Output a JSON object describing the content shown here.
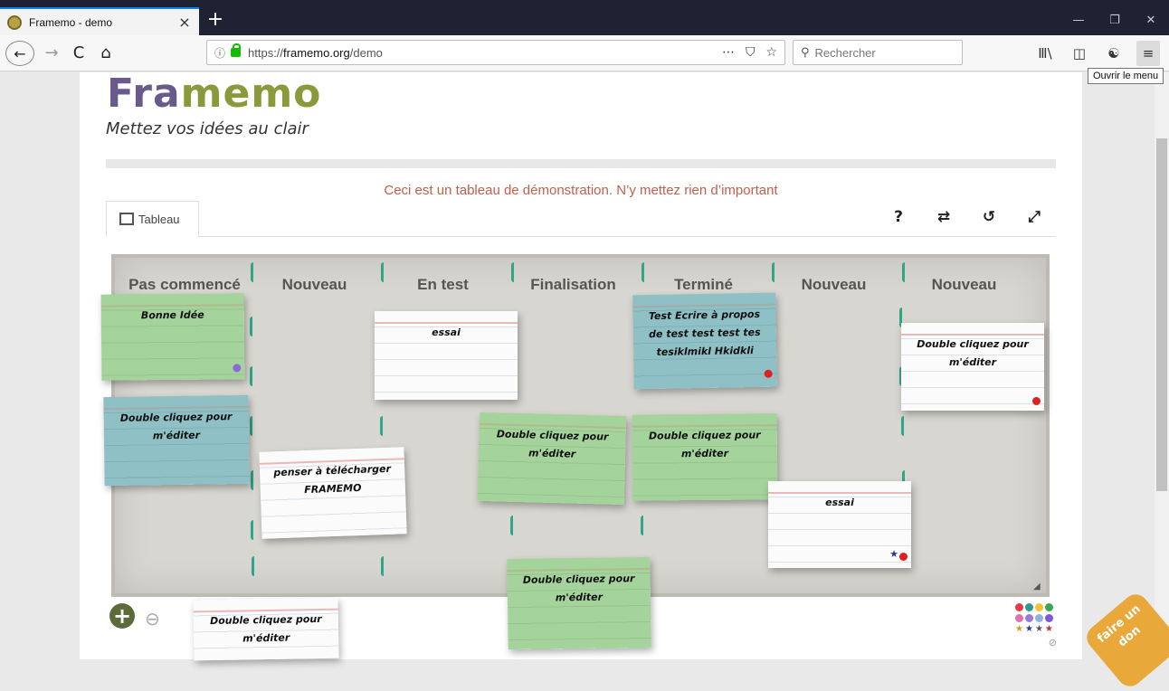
{
  "browser": {
    "tab_title": "Framemo - demo",
    "tab_close": "×",
    "new_tab": "+",
    "window_buttons": [
      "—",
      "❐",
      "✕"
    ],
    "url_host": "https://",
    "url_domain": "framemo.org",
    "url_path": "/demo",
    "url_icons": [
      "⋯",
      "⛉",
      "☆"
    ],
    "search_placeholder": "Rechercher",
    "tooltip": "Ouvrir le menu",
    "nav_back": "←",
    "nav_forward": "→",
    "nav_reload": "C",
    "nav_home": "⌂",
    "toolbar_icons": [
      "Ⅲ\\",
      "◫",
      "☯",
      "≡"
    ]
  },
  "header": {
    "logo_part1": "Fra",
    "logo_part2": "memo",
    "tagline": "Mettez vos idées au clair",
    "demo_message": "Ceci est un tableau de démonstration. N’y mettez rien d’important",
    "tab_label": "Tableau",
    "tools": [
      "?",
      "⇄",
      "↺",
      "⤢"
    ]
  },
  "columns": [
    "Pas commencé",
    "Nouveau",
    "En test",
    "Finalisation",
    "Terminé",
    "Nouveau",
    "Nouveau"
  ],
  "notes": [
    {
      "text": "Bonne Idée",
      "color": "green"
    },
    {
      "text": "Double cliquez pour m'éditer",
      "color": "blue"
    },
    {
      "text": "penser à télécharger FRAMEMO",
      "color": "white"
    },
    {
      "text": "essai",
      "color": "white"
    },
    {
      "text": "Double cliquez pour m'éditer",
      "color": "green"
    },
    {
      "text": "Test Ecrire à propos de test test test tes tesiklmikl Hkidkli",
      "color": "blue"
    },
    {
      "text": "Double cliquez pour m'éditer",
      "color": "green"
    },
    {
      "text": "essai",
      "color": "white"
    },
    {
      "text": "Double cliquez pour m'éditer",
      "color": "white"
    },
    {
      "text": "Double cliquez pour m'éditer",
      "color": "green"
    },
    {
      "text": "Double cliquez pour m'éditer",
      "color": "white"
    }
  ],
  "palette_colors": [
    "#e63946",
    "#2a9d8f",
    "#f4c430",
    "#3aa655",
    "#e070b0",
    "#9a7ad8",
    "#8fb0e0",
    "#7a5ad8"
  ],
  "palette_stars": [
    "★",
    "★",
    "★",
    "★"
  ],
  "palette_none": "⊘",
  "zoom": {
    "plus": "+",
    "minus": "⊖"
  },
  "don_text": "faire un don",
  "accent_colors": {
    "tab_accent": "#0a84ff",
    "logo_fra": "#6a5a8c",
    "logo_memo": "#8a9a3a",
    "demo_message": "#c0604a",
    "marker_red": "#e02020",
    "marker_purple": "#8a6ad8"
  }
}
